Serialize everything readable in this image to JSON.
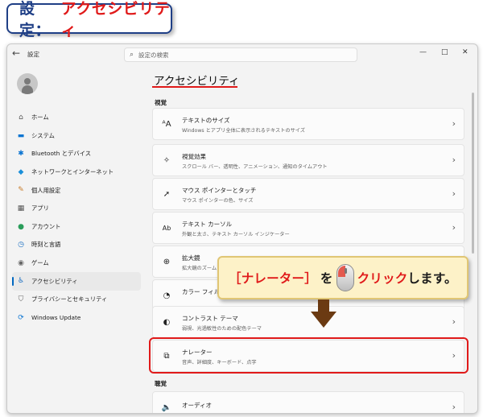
{
  "badge": {
    "part1": "設定：",
    "part2": "アクセシビリティ"
  },
  "window": {
    "back_icon": "←",
    "app_title": "設定",
    "search_placeholder": "設定の検索",
    "minimize": "—",
    "maximize": "□",
    "close": "✕"
  },
  "sidebar": {
    "items": [
      {
        "label": "ホーム",
        "icon": "home-icon",
        "glyph": "⌂"
      },
      {
        "label": "システム",
        "icon": "system-icon",
        "glyph": "▬"
      },
      {
        "label": "Bluetooth とデバイス",
        "icon": "bluetooth-icon",
        "glyph": "✱"
      },
      {
        "label": "ネットワークとインターネット",
        "icon": "network-icon",
        "glyph": "◆"
      },
      {
        "label": "個人用設定",
        "icon": "brush-icon",
        "glyph": "✎"
      },
      {
        "label": "アプリ",
        "icon": "apps-icon",
        "glyph": "▦"
      },
      {
        "label": "アカウント",
        "icon": "account-icon",
        "glyph": "●"
      },
      {
        "label": "時刻と言語",
        "icon": "time-language-icon",
        "glyph": "◷"
      },
      {
        "label": "ゲーム",
        "icon": "gaming-icon",
        "glyph": "◉"
      },
      {
        "label": "アクセシビリティ",
        "icon": "accessibility-icon",
        "glyph": "♿"
      },
      {
        "label": "プライバシーとセキュリティ",
        "icon": "shield-icon",
        "glyph": "⛉"
      },
      {
        "label": "Windows Update",
        "icon": "update-icon",
        "glyph": "⟳"
      }
    ],
    "active_index": 9
  },
  "main": {
    "title": "アクセシビリティ",
    "section_vision": "視覚",
    "section_hearing": "聴覚",
    "cards": [
      {
        "title": "テキストのサイズ",
        "subtitle": "Windows とアプリ全体に表示されるテキストのサイズ",
        "icon": "text-size-icon",
        "glyph": "ᴬA"
      },
      {
        "title": "視覚効果",
        "subtitle": "スクロール バー、透明性、アニメーション、通知のタイムアウト",
        "icon": "visual-effects-icon",
        "glyph": "✧"
      },
      {
        "title": "マウス ポインターとタッチ",
        "subtitle": "マウス ポインターの色、サイズ",
        "icon": "mouse-pointer-icon",
        "glyph": "➚"
      },
      {
        "title": "テキスト カーソル",
        "subtitle": "外観と太さ、テキスト カーソル インジケーター",
        "icon": "text-cursor-icon",
        "glyph": "Ab"
      },
      {
        "title": "拡大鏡",
        "subtitle": "拡大鏡のズーム",
        "icon": "magnifier-icon",
        "glyph": "⊕"
      },
      {
        "title": "カラー フィルター",
        "subtitle": "",
        "icon": "color-filter-icon",
        "glyph": "◔"
      },
      {
        "title": "コントラスト テーマ",
        "subtitle": "弱視、光過敏性のための配色テーマ",
        "icon": "contrast-icon",
        "glyph": "◐"
      },
      {
        "title": "ナレーター",
        "subtitle": "音声、詳細度、キーボード、点字",
        "icon": "narrator-icon",
        "glyph": "⧉"
      }
    ],
    "audio_card": {
      "title": "オーディオ",
      "icon": "audio-icon",
      "glyph": "🔈"
    },
    "chevron": "›"
  },
  "callout": {
    "part1": "［ナレーター］",
    "part2": "を",
    "part3": "クリック",
    "part4": "します。"
  }
}
